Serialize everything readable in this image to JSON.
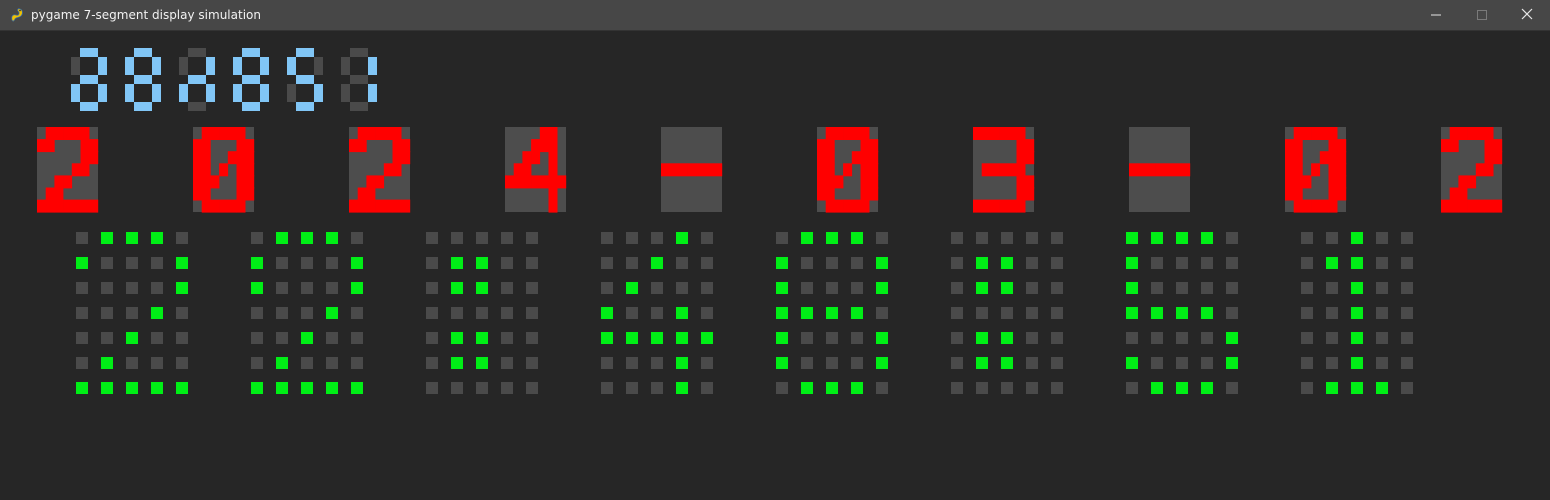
{
  "window": {
    "title": "pygame 7-segment display simulation",
    "icon": "pygame-snake-icon",
    "controls": [
      "minimize-icon",
      "maximize-icon",
      "close-icon"
    ]
  },
  "colors": {
    "background": "#262626",
    "titlebar": "#474747",
    "segment_off": "#4a4a4a",
    "blue_on": "#81c6f6",
    "red_on": "#ff0000",
    "red_cell_bg": "#4d4d4d",
    "green_on": "#00ee16"
  },
  "blue_display": {
    "description_of_shown_value": "8-segment pixel digits",
    "digits": [
      {
        "a": 1,
        "b": 1,
        "c": 1,
        "d": 1,
        "e": 1,
        "f": 0,
        "g": 1
      },
      {
        "a": 1,
        "b": 1,
        "c": 1,
        "d": 1,
        "e": 1,
        "f": 1,
        "g": 1
      },
      {
        "a": 0,
        "b": 1,
        "c": 1,
        "d": 0,
        "e": 1,
        "f": 0,
        "g": 1
      },
      {
        "a": 1,
        "b": 1,
        "c": 1,
        "d": 1,
        "e": 1,
        "f": 1,
        "g": 1
      },
      {
        "a": 1,
        "b": 0,
        "c": 1,
        "d": 1,
        "e": 0,
        "f": 1,
        "g": 1
      },
      {
        "a": 0,
        "b": 1,
        "c": 1,
        "d": 0,
        "e": 0,
        "f": 0,
        "g": 0
      }
    ]
  },
  "red_display": {
    "characters": [
      "2",
      "0",
      "2",
      "4",
      "-",
      "0",
      "3",
      "-",
      "0",
      "2"
    ]
  },
  "green_matrix": {
    "glyphs": [
      [
        "01110",
        "10001",
        "00001",
        "00010",
        "00100",
        "01000",
        "11111"
      ],
      [
        "01110",
        "10001",
        "10001",
        "00010",
        "00100",
        "01000",
        "11111"
      ],
      [
        "00000",
        "01100",
        "01100",
        "00000",
        "01100",
        "01100",
        "00000"
      ],
      [
        "00010",
        "00100",
        "01000",
        "10010",
        "11111",
        "00010",
        "00010"
      ],
      [
        "01110",
        "10001",
        "10001",
        "11110",
        "10001",
        "10001",
        "01110"
      ],
      [
        "00000",
        "01100",
        "01100",
        "00000",
        "01100",
        "01100",
        "00000"
      ],
      [
        "11110",
        "10000",
        "10000",
        "11110",
        "00001",
        "10001",
        "01110"
      ],
      [
        "00100",
        "01100",
        "00100",
        "00100",
        "00100",
        "00100",
        "01110"
      ]
    ]
  }
}
